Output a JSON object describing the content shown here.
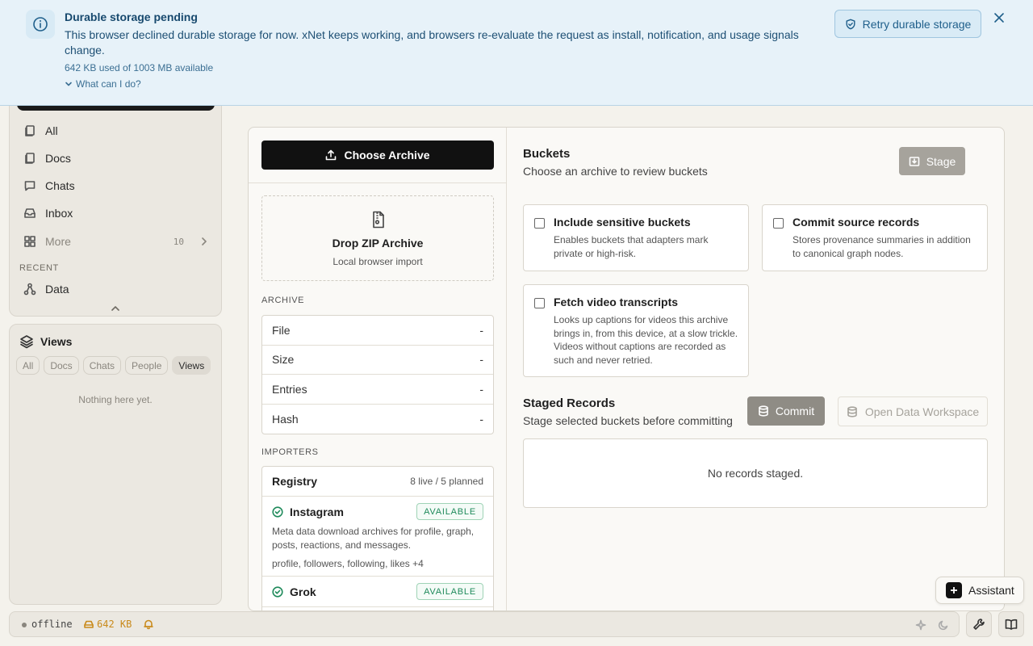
{
  "banner": {
    "title": "Durable storage pending",
    "message": "This browser declined durable storage for now. xNet keeps working, and browsers re-evaluate the request as install, notification, and usage signals change.",
    "usage": "642 KB used of 1003 MB available",
    "what_can_i_do": "What can I do?",
    "retry_label": "Retry durable storage",
    "icon": "info-icon"
  },
  "sidebar": {
    "items": [
      {
        "label": "All",
        "icon": "pages-icon"
      },
      {
        "label": "Docs",
        "icon": "docs-icon"
      },
      {
        "label": "Chats",
        "icon": "chat-icon"
      },
      {
        "label": "Inbox",
        "icon": "inbox-icon"
      },
      {
        "label": "More",
        "icon": "grid-icon",
        "count": "10"
      }
    ],
    "recent_label": "RECENT",
    "recent_items": [
      {
        "label": "Data",
        "icon": "graph-icon"
      }
    ]
  },
  "views": {
    "title": "Views",
    "chips": [
      "All",
      "Docs",
      "Chats",
      "People",
      "Views"
    ],
    "active_chip": "Views",
    "empty": "Nothing here yet."
  },
  "archive_panel": {
    "choose_label": "Choose Archive",
    "drop_title": "Drop ZIP Archive",
    "drop_subtitle": "Local browser import",
    "archive_label": "ARCHIVE",
    "archive_rows": [
      {
        "key": "File",
        "value": "-"
      },
      {
        "key": "Size",
        "value": "-"
      },
      {
        "key": "Entries",
        "value": "-"
      },
      {
        "key": "Hash",
        "value": "-"
      }
    ],
    "importers_label": "IMPORTERS",
    "registry_title": "Registry",
    "registry_count": "8 live / 5 planned",
    "importers": [
      {
        "name": "Instagram",
        "status": "AVAILABLE",
        "description": "Meta data download archives for profile, graph, posts, reactions, and messages.",
        "tags": "profile, followers, following, likes +4"
      },
      {
        "name": "Grok",
        "status": "AVAILABLE",
        "description": "",
        "tags": ""
      }
    ]
  },
  "buckets": {
    "title": "Buckets",
    "subtitle": "Choose an archive to review buckets",
    "stage_label": "Stage",
    "options": [
      {
        "title": "Include sensitive buckets",
        "description": "Enables buckets that adapters mark private or high-risk.",
        "checked": false
      },
      {
        "title": "Commit source records",
        "description": "Stores provenance summaries in addition to canonical graph nodes.",
        "checked": false
      },
      {
        "title": "Fetch video transcripts",
        "description": "Looks up captions for videos this archive brings in, from this device, at a slow trickle. Videos without captions are recorded as such and never retried.",
        "checked": false
      }
    ]
  },
  "staged": {
    "title": "Staged Records",
    "subtitle": "Stage selected buckets before committing",
    "commit_label": "Commit",
    "workspace_label": "Open Data Workspace",
    "empty": "No records staged."
  },
  "assistant": {
    "label": "Assistant"
  },
  "statusbar": {
    "connection": "offline",
    "storage": "642 KB"
  },
  "colors": {
    "banner_bg": "#e7f2f9",
    "banner_text": "#1d4f74",
    "available_green": "#1f8a5b",
    "warning_amber": "#c98a1b"
  }
}
